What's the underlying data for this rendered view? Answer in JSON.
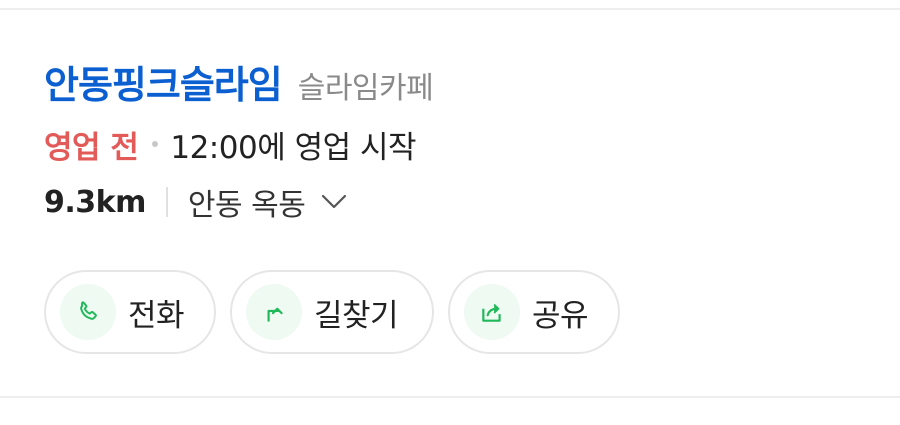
{
  "place": {
    "name": "안동핑크슬라임",
    "category": "슬라임카페"
  },
  "status": {
    "label": "영업 전",
    "hours": "12:00에 영업 시작"
  },
  "location": {
    "distance": "9.3km",
    "address": "안동 옥동"
  },
  "actions": [
    {
      "label": "전화",
      "icon": "phone-icon"
    },
    {
      "label": "길찾기",
      "icon": "directions-icon"
    },
    {
      "label": "공유",
      "icon": "share-icon"
    }
  ],
  "colors": {
    "title": "#0b5fd0",
    "status": "#e25b59",
    "accent": "#21b85a"
  }
}
